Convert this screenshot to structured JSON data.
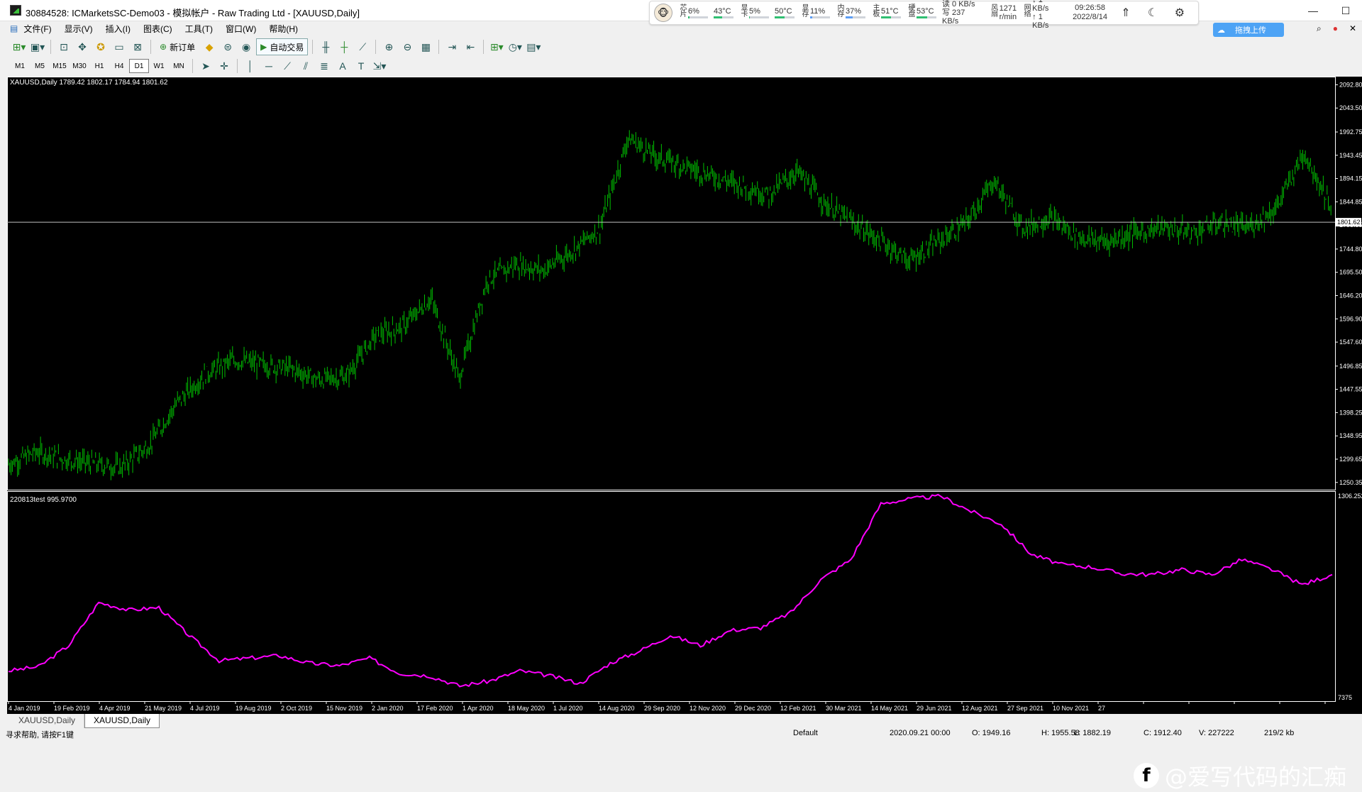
{
  "window": {
    "title": "30884528: ICMarketsSC-Demo03 - 模拟帐户 - Raw Trading Ltd - [XAUUSD,Daily]",
    "minimize": "—",
    "maximize": "☐"
  },
  "sysmon": {
    "items": [
      {
        "label": "芯片",
        "value": "6%",
        "bar": 0.06,
        "color": "#2fbf71"
      },
      {
        "label": "",
        "value": "43°C",
        "bar": 0.43,
        "color": "#2fbf71"
      },
      {
        "label": "显卡",
        "value": "5%",
        "bar": 0.05,
        "color": "#2fbf71"
      },
      {
        "label": "",
        "value": "50°C",
        "bar": 0.5,
        "color": "#2fbf71"
      },
      {
        "label": "显存",
        "value": "11%",
        "bar": 0.11,
        "color": "#5b9df5"
      },
      {
        "label": "内存",
        "value": "37%",
        "bar": 0.37,
        "color": "#5b9df5"
      },
      {
        "label": "主板",
        "value": "51°C",
        "bar": 0.51,
        "color": "#2fbf71"
      },
      {
        "label": "硬盘",
        "value": "53°C",
        "bar": 0.53,
        "color": "#2fbf71"
      }
    ],
    "disk_read": "读 0 KB/s",
    "disk_write": "写 237 KB/s",
    "fan_label": "风扇",
    "fan_value": "1271",
    "fan_unit": "r/min",
    "net_label": "网络",
    "net_down": "↓ 1 KB/s",
    "net_up": "↑ 1 KB/s",
    "time": "09:26:58",
    "date": "2022/8/14",
    "cloud": "拖拽上传"
  },
  "menu": [
    "文件(F)",
    "显示(V)",
    "插入(I)",
    "图表(C)",
    "工具(T)",
    "窗口(W)",
    "帮助(H)"
  ],
  "toolbar": {
    "new_order": "新订单",
    "auto_trading": "自动交易"
  },
  "timeframes": [
    "M1",
    "M5",
    "M15",
    "M30",
    "H1",
    "H4",
    "D1",
    "W1",
    "MN"
  ],
  "active_timeframe": "D1",
  "chart": {
    "header": "XAUUSD,Daily  1789.42 1802.17 1784.94 1801.62",
    "indicator_header": "220813test 995.9700",
    "current_price": "1801.62",
    "indicator_top": "1306.252",
    "indicator_bottom": "7375"
  },
  "chart_data": {
    "type": "line",
    "symbol": "XAUUSD",
    "timeframe": "Daily",
    "y_ticks": [
      "2092.80",
      "2043.50",
      "1992.75",
      "1943.45",
      "1894.15",
      "1844.85",
      "1795.55",
      "1744.80",
      "1695.50",
      "1646.20",
      "1596.90",
      "1547.60",
      "1496.85",
      "1447.55",
      "1398.25",
      "1348.95",
      "1299.65",
      "1250.35"
    ],
    "x_ticks": [
      "4 Jan 2019",
      "19 Feb 2019",
      "4 Apr 2019",
      "21 May 2019",
      "4 Jul 2019",
      "19 Aug 2019",
      "2 Oct 2019",
      "15 Nov 2019",
      "2 Jan 2020",
      "17 Feb 2020",
      "1 Apr 2020",
      "18 May 2020",
      "1 Jul 2020",
      "14 Aug 2020",
      "29 Sep 2020",
      "12 Nov 2020",
      "29 Dec 2020",
      "12 Feb 2021",
      "30 Mar 2021",
      "14 May 2021",
      "29 Jun 2021",
      "12 Aug 2021",
      "27 Sep 2021",
      "10 Nov 2021",
      "27",
      "",
      "",
      "",
      "",
      ""
    ],
    "price_series": {
      "name": "XAUUSD,Daily",
      "color": "#00c000",
      "x_index": [
        0,
        20,
        40,
        60,
        80,
        100,
        120,
        140,
        160,
        180,
        200,
        220,
        240,
        260,
        280,
        300,
        320,
        340,
        360,
        380,
        400,
        420,
        440,
        460,
        480,
        500,
        520,
        540,
        560,
        580,
        600,
        620,
        640,
        660,
        680,
        700,
        720,
        740,
        760,
        780,
        800,
        820,
        840,
        860,
        880,
        900,
        920,
        940
      ],
      "values": [
        1289,
        1315,
        1300,
        1290,
        1282,
        1330,
        1420,
        1480,
        1510,
        1500,
        1492,
        1468,
        1475,
        1560,
        1580,
        1640,
        1470,
        1680,
        1712,
        1700,
        1740,
        1790,
        1980,
        1940,
        1920,
        1900,
        1880,
        1860,
        1910,
        1840,
        1800,
        1760,
        1720,
        1760,
        1800,
        1890,
        1790,
        1810,
        1770,
        1760,
        1780,
        1790,
        1780,
        1800,
        1790,
        1830,
        1950,
        1830
      ]
    },
    "indicator_series": {
      "name": "220813test",
      "color": "#ff00ff",
      "values": [
        960,
        968,
        1010,
        1095,
        1080,
        1085,
        1030,
        980,
        985,
        990,
        975,
        970,
        985,
        955,
        950,
        930,
        940,
        960,
        950,
        935,
        975,
        1000,
        1030,
        1010,
        1040,
        1045,
        1075,
        1140,
        1180,
        1290,
        1300,
        1305,
        1275,
        1250,
        1190,
        1170,
        1165,
        1152,
        1150,
        1160,
        1150,
        1180,
        1160,
        1130,
        1150
      ]
    }
  },
  "tabs": [
    "XAUUSD,Daily",
    "XAUUSD,Daily"
  ],
  "active_tab": 1,
  "status": {
    "help": "寻求帮助, 请按F1键",
    "profile": "Default",
    "datetime": "2020.09.21 00:00",
    "open": "O: 1949.16",
    "high": "H: 1955.58",
    "low": "L: 1882.19",
    "close": "C: 1912.40",
    "volume": "V: 227222",
    "traffic": "219/2 kb"
  },
  "watermark": "@爱写代码的汇痴"
}
